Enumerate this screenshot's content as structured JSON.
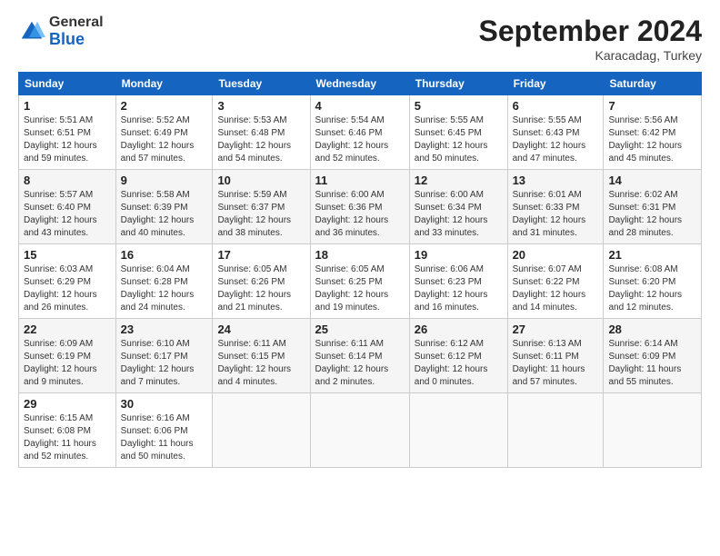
{
  "header": {
    "logo_general": "General",
    "logo_blue": "Blue",
    "month_title": "September 2024",
    "subtitle": "Karacadag, Turkey"
  },
  "columns": [
    "Sunday",
    "Monday",
    "Tuesday",
    "Wednesday",
    "Thursday",
    "Friday",
    "Saturday"
  ],
  "weeks": [
    [
      {
        "day": "1",
        "info": "Sunrise: 5:51 AM\nSunset: 6:51 PM\nDaylight: 12 hours\nand 59 minutes."
      },
      {
        "day": "2",
        "info": "Sunrise: 5:52 AM\nSunset: 6:49 PM\nDaylight: 12 hours\nand 57 minutes."
      },
      {
        "day": "3",
        "info": "Sunrise: 5:53 AM\nSunset: 6:48 PM\nDaylight: 12 hours\nand 54 minutes."
      },
      {
        "day": "4",
        "info": "Sunrise: 5:54 AM\nSunset: 6:46 PM\nDaylight: 12 hours\nand 52 minutes."
      },
      {
        "day": "5",
        "info": "Sunrise: 5:55 AM\nSunset: 6:45 PM\nDaylight: 12 hours\nand 50 minutes."
      },
      {
        "day": "6",
        "info": "Sunrise: 5:55 AM\nSunset: 6:43 PM\nDaylight: 12 hours\nand 47 minutes."
      },
      {
        "day": "7",
        "info": "Sunrise: 5:56 AM\nSunset: 6:42 PM\nDaylight: 12 hours\nand 45 minutes."
      }
    ],
    [
      {
        "day": "8",
        "info": "Sunrise: 5:57 AM\nSunset: 6:40 PM\nDaylight: 12 hours\nand 43 minutes."
      },
      {
        "day": "9",
        "info": "Sunrise: 5:58 AM\nSunset: 6:39 PM\nDaylight: 12 hours\nand 40 minutes."
      },
      {
        "day": "10",
        "info": "Sunrise: 5:59 AM\nSunset: 6:37 PM\nDaylight: 12 hours\nand 38 minutes."
      },
      {
        "day": "11",
        "info": "Sunrise: 6:00 AM\nSunset: 6:36 PM\nDaylight: 12 hours\nand 36 minutes."
      },
      {
        "day": "12",
        "info": "Sunrise: 6:00 AM\nSunset: 6:34 PM\nDaylight: 12 hours\nand 33 minutes."
      },
      {
        "day": "13",
        "info": "Sunrise: 6:01 AM\nSunset: 6:33 PM\nDaylight: 12 hours\nand 31 minutes."
      },
      {
        "day": "14",
        "info": "Sunrise: 6:02 AM\nSunset: 6:31 PM\nDaylight: 12 hours\nand 28 minutes."
      }
    ],
    [
      {
        "day": "15",
        "info": "Sunrise: 6:03 AM\nSunset: 6:29 PM\nDaylight: 12 hours\nand 26 minutes."
      },
      {
        "day": "16",
        "info": "Sunrise: 6:04 AM\nSunset: 6:28 PM\nDaylight: 12 hours\nand 24 minutes."
      },
      {
        "day": "17",
        "info": "Sunrise: 6:05 AM\nSunset: 6:26 PM\nDaylight: 12 hours\nand 21 minutes."
      },
      {
        "day": "18",
        "info": "Sunrise: 6:05 AM\nSunset: 6:25 PM\nDaylight: 12 hours\nand 19 minutes."
      },
      {
        "day": "19",
        "info": "Sunrise: 6:06 AM\nSunset: 6:23 PM\nDaylight: 12 hours\nand 16 minutes."
      },
      {
        "day": "20",
        "info": "Sunrise: 6:07 AM\nSunset: 6:22 PM\nDaylight: 12 hours\nand 14 minutes."
      },
      {
        "day": "21",
        "info": "Sunrise: 6:08 AM\nSunset: 6:20 PM\nDaylight: 12 hours\nand 12 minutes."
      }
    ],
    [
      {
        "day": "22",
        "info": "Sunrise: 6:09 AM\nSunset: 6:19 PM\nDaylight: 12 hours\nand 9 minutes."
      },
      {
        "day": "23",
        "info": "Sunrise: 6:10 AM\nSunset: 6:17 PM\nDaylight: 12 hours\nand 7 minutes."
      },
      {
        "day": "24",
        "info": "Sunrise: 6:11 AM\nSunset: 6:15 PM\nDaylight: 12 hours\nand 4 minutes."
      },
      {
        "day": "25",
        "info": "Sunrise: 6:11 AM\nSunset: 6:14 PM\nDaylight: 12 hours\nand 2 minutes."
      },
      {
        "day": "26",
        "info": "Sunrise: 6:12 AM\nSunset: 6:12 PM\nDaylight: 12 hours\nand 0 minutes."
      },
      {
        "day": "27",
        "info": "Sunrise: 6:13 AM\nSunset: 6:11 PM\nDaylight: 11 hours\nand 57 minutes."
      },
      {
        "day": "28",
        "info": "Sunrise: 6:14 AM\nSunset: 6:09 PM\nDaylight: 11 hours\nand 55 minutes."
      }
    ],
    [
      {
        "day": "29",
        "info": "Sunrise: 6:15 AM\nSunset: 6:08 PM\nDaylight: 11 hours\nand 52 minutes."
      },
      {
        "day": "30",
        "info": "Sunrise: 6:16 AM\nSunset: 6:06 PM\nDaylight: 11 hours\nand 50 minutes."
      },
      {
        "day": "",
        "info": ""
      },
      {
        "day": "",
        "info": ""
      },
      {
        "day": "",
        "info": ""
      },
      {
        "day": "",
        "info": ""
      },
      {
        "day": "",
        "info": ""
      }
    ]
  ]
}
